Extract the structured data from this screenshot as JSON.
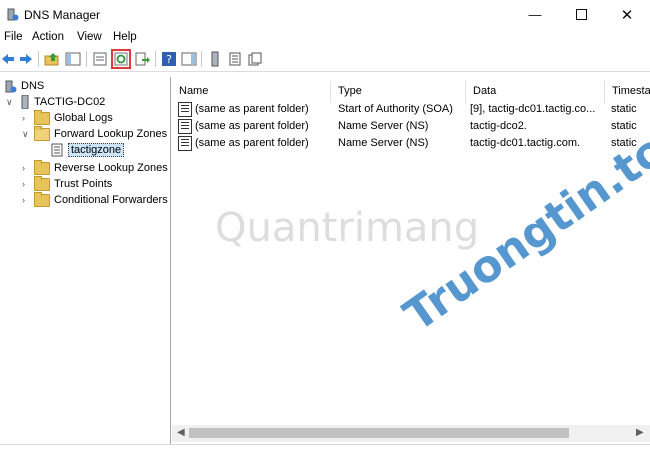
{
  "window": {
    "title": "DNS Manager"
  },
  "menu": [
    "File",
    "Action",
    "View",
    "Help"
  ],
  "toolbar": {
    "icons": [
      "back-arrow-icon",
      "forward-arrow-icon",
      "up-folder-icon",
      "show-hide-tree-icon",
      "properties-icon",
      "refresh-icon",
      "export-list-icon",
      "help-icon",
      "action-pane-icon",
      "server-icon",
      "zone-icon",
      "record-icon"
    ]
  },
  "tree": {
    "root": "DNS",
    "server": "TACTIG-DC02",
    "items": [
      "Global Logs",
      "Forward Lookup Zones",
      "tactigzone",
      "Reverse Lookup Zones",
      "Trust Points",
      "Conditional Forwarders"
    ]
  },
  "list": {
    "columns": [
      "Name",
      "Type",
      "Data",
      "Timestamp"
    ],
    "rows": [
      [
        "(same as parent folder)",
        "Start of Authority (SOA)",
        "[9], tactig-dc01.tactig.co...",
        "static"
      ],
      [
        "(same as parent folder)",
        "Name Server (NS)",
        "tactig-dco2.",
        "static"
      ],
      [
        "(same as parent folder)",
        "Name Server (NS)",
        "tactig-dc01.tactig.com.",
        "static"
      ]
    ]
  },
  "watermarks": {
    "quantrimang": "Quantrimang",
    "truongtin": "Truongtin.top"
  },
  "colors": {
    "highlight_box": "#e03a3a",
    "selection": "#cce4f7"
  }
}
